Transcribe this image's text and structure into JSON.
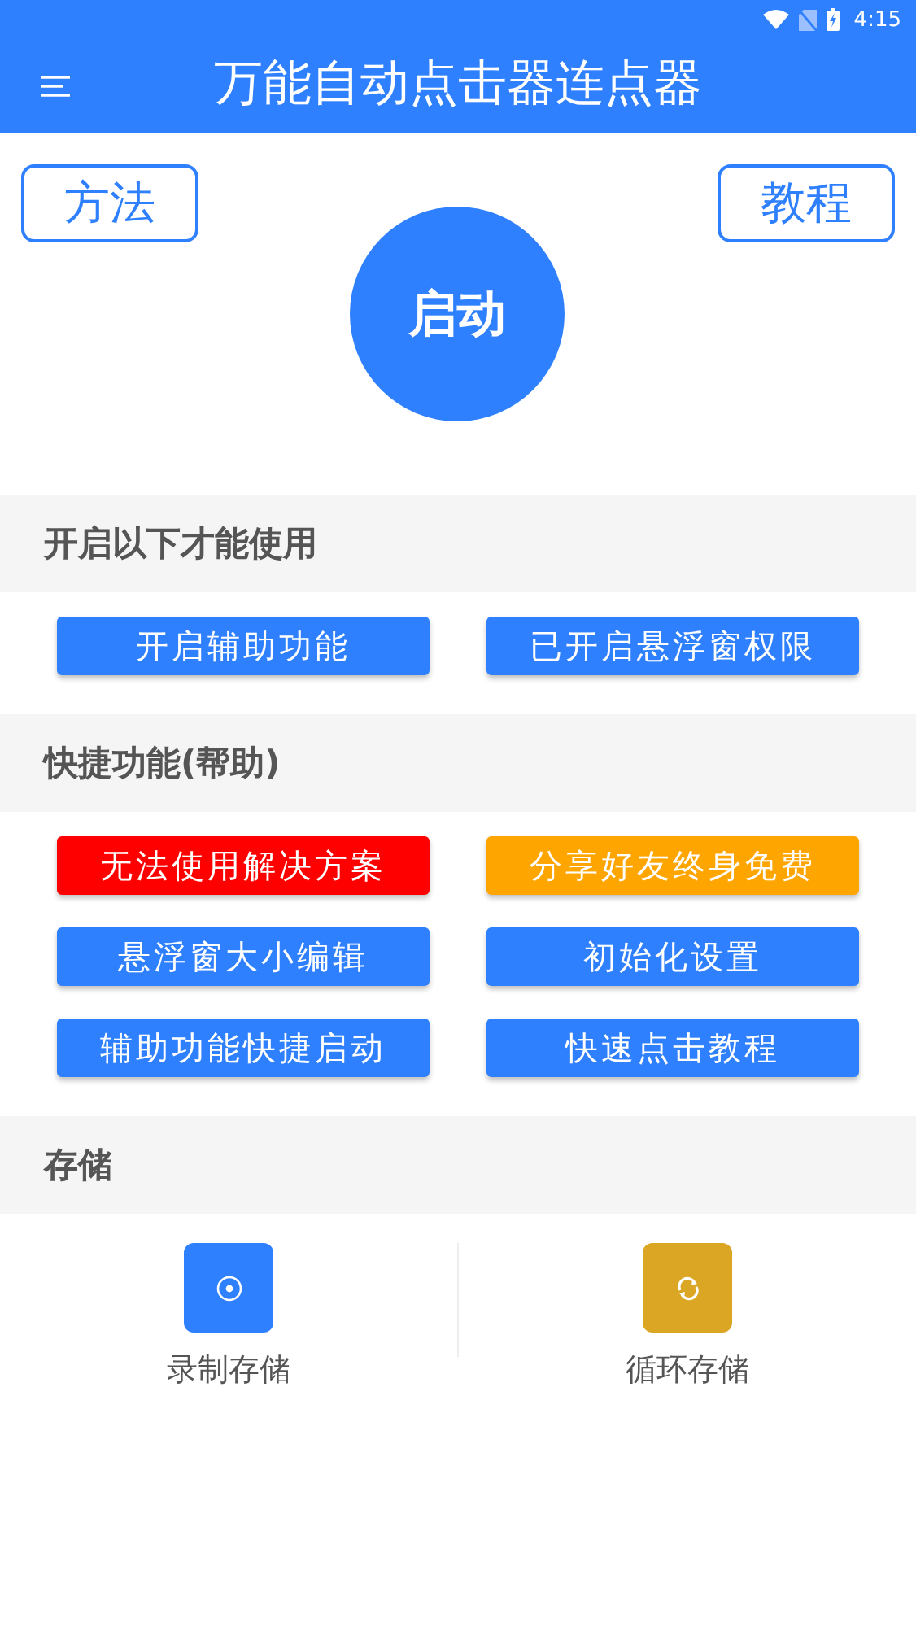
{
  "status_bar": {
    "time": "4:15"
  },
  "app_bar": {
    "title": "万能自动点击器连点器"
  },
  "top_buttons": [
    {
      "label": "方法"
    },
    {
      "label": "教程"
    }
  ],
  "start_button": {
    "label": "启动"
  },
  "sections": [
    {
      "title": "开启以下才能使用",
      "buttons": [
        {
          "label": "开启辅助功能",
          "color": "#2f80fe"
        },
        {
          "label": "已开启悬浮窗权限",
          "color": "#2f80fe"
        }
      ]
    },
    {
      "title": "快捷功能(帮助)",
      "buttons": [
        {
          "label": "无法使用解决方案",
          "color": "#fe0000"
        },
        {
          "label": "分享好友终身免费",
          "color": "#ffa500"
        },
        {
          "label": "悬浮窗大小编辑",
          "color": "#2f80fe"
        },
        {
          "label": "初始化设置",
          "color": "#2f80fe"
        },
        {
          "label": "辅助功能快捷启动",
          "color": "#2f80fe"
        },
        {
          "label": "快速点击教程",
          "color": "#2f80fe"
        }
      ]
    },
    {
      "title": "存储",
      "tiles": [
        {
          "label": "录制存储",
          "kind": "record",
          "color": "#2f80fe"
        },
        {
          "label": "循环存储",
          "kind": "loop",
          "color": "#dba623"
        }
      ]
    }
  ]
}
